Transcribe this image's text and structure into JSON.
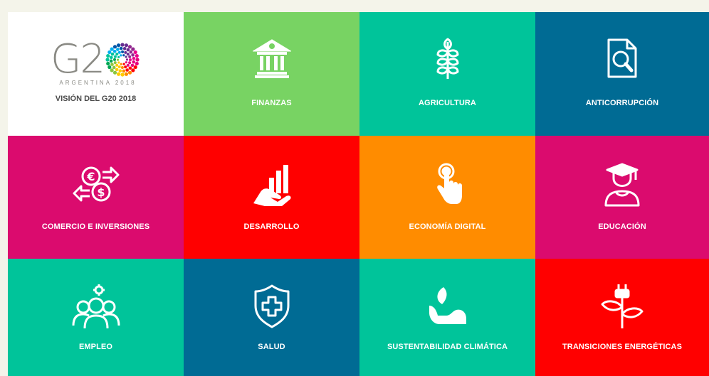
{
  "logo": {
    "mark_text": "G2",
    "sub_text": "ARGENTINA 2018",
    "label": "VISIÓN DEL G20 2018"
  },
  "tiles": [
    {
      "label": "FINANZAS",
      "color": "#78d363",
      "icon": "bank-icon"
    },
    {
      "label": "AGRICULTURA",
      "color": "#00c49a",
      "icon": "wheat-icon"
    },
    {
      "label": "ANTICORRUPCIÓN",
      "color": "#006b94",
      "icon": "document-search-icon"
    },
    {
      "label": "COMERCIO E INVERSIONES",
      "color": "#db0b6e",
      "icon": "currency-exchange-icon"
    },
    {
      "label": "DESARROLLO",
      "color": "#ff0000",
      "icon": "hand-growth-chart-icon"
    },
    {
      "label": "ECONOMÍA DIGITAL",
      "color": "#ff8c00",
      "icon": "touch-finger-icon"
    },
    {
      "label": "EDUCACIÓN",
      "color": "#db0b6e",
      "icon": "graduate-icon"
    },
    {
      "label": "EMPLEO",
      "color": "#00c49a",
      "icon": "team-gear-icon"
    },
    {
      "label": "SALUD",
      "color": "#006b94",
      "icon": "health-shield-icon"
    },
    {
      "label": "SUSTENTABILIDAD CLIMÁTICA",
      "color": "#00c49a",
      "icon": "hand-leaf-icon"
    },
    {
      "label": "TRANSICIONES ENERGÉTICAS",
      "color": "#ff0000",
      "icon": "plant-plug-icon"
    }
  ]
}
